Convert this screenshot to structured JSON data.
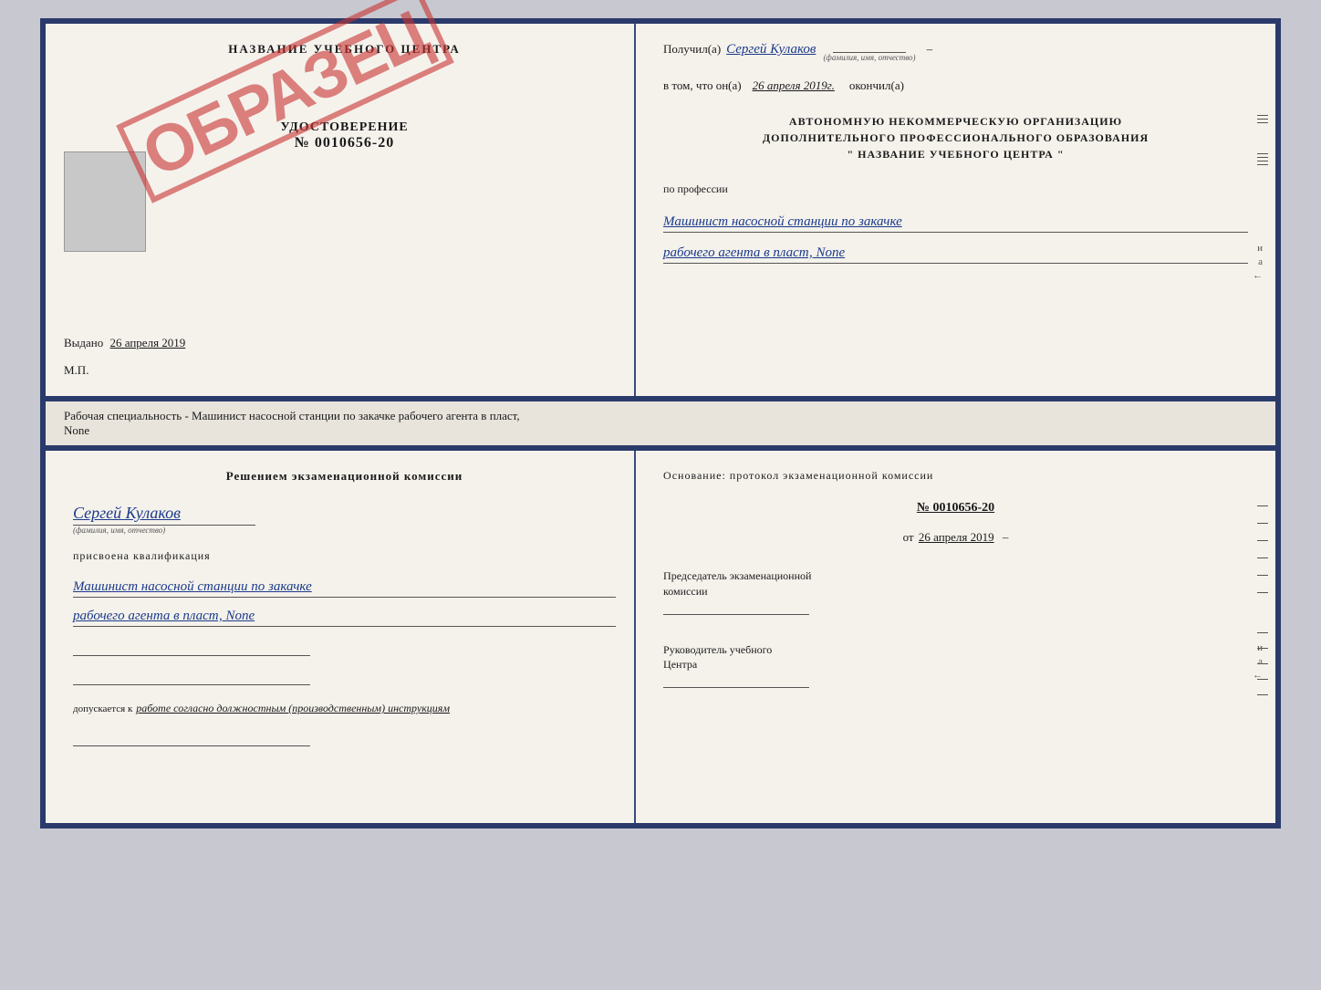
{
  "topDoc": {
    "left": {
      "title": "НАЗВАНИЕ УЧЕБНОГО ЦЕНТРА",
      "stamp": "ОБРАЗЕЦ",
      "udostoverenie": "УДОСТОВЕРЕНИЕ",
      "number": "№ 0010656-20",
      "vydano": "Выдано",
      "vydano_date": "26 апреля 2019",
      "mp": "М.П."
    },
    "right": {
      "poluchil_label": "Получил(а)",
      "poluchil_name": "Сергей Кулаков",
      "familiya_label": "(фамилия, имя, отчество)",
      "vtom_label": "в том, что он(а)",
      "vtom_date": "26 апреля 2019г.",
      "okonchil": "окончил(а)",
      "center_line1": "АВТОНОМНУЮ НЕКОММЕРЧЕСКУЮ ОРГАНИЗАЦИЮ",
      "center_line2": "ДОПОЛНИТЕЛЬНОГО ПРОФЕССИОНАЛЬНОГО ОБРАЗОВАНИЯ",
      "center_line3": "\"   НАЗВАНИЕ УЧЕБНОГО ЦЕНТРА   \"",
      "po_professii": "по профессии",
      "profession_line1": "Машинист насосной станции по закачке",
      "profession_line2": "рабочего агента в пласт, None"
    }
  },
  "separatorText": "Рабочая специальность - Машинист насосной станции по закачке рабочего агента в пласт,",
  "separatorText2": "None",
  "bottomDoc": {
    "left": {
      "resheniem": "Решением экзаменационной комиссии",
      "name": "Сергей Кулаков",
      "familiya_label": "(фамилия, имя, отчество)",
      "prisvoena": "присвоена квалификация",
      "profession_line1": "Машинист насосной станции по закачке",
      "profession_line2": "рабочего агента в пласт, None",
      "dopuskaetsya": "допускается к",
      "rabote_label": "работе согласно должностным (производственным) инструкциям"
    },
    "right": {
      "osnovanie": "Основание: протокол экзаменационной комиссии",
      "protocol_number": "№ 0010656-20",
      "ot_label": "от",
      "ot_date": "26 апреля 2019",
      "predsedatel_line1": "Председатель экзаменационной",
      "predsedatel_line2": "комиссии",
      "rukovoditel_line1": "Руководитель учебного",
      "rukovoditel_line2": "Центра"
    }
  }
}
